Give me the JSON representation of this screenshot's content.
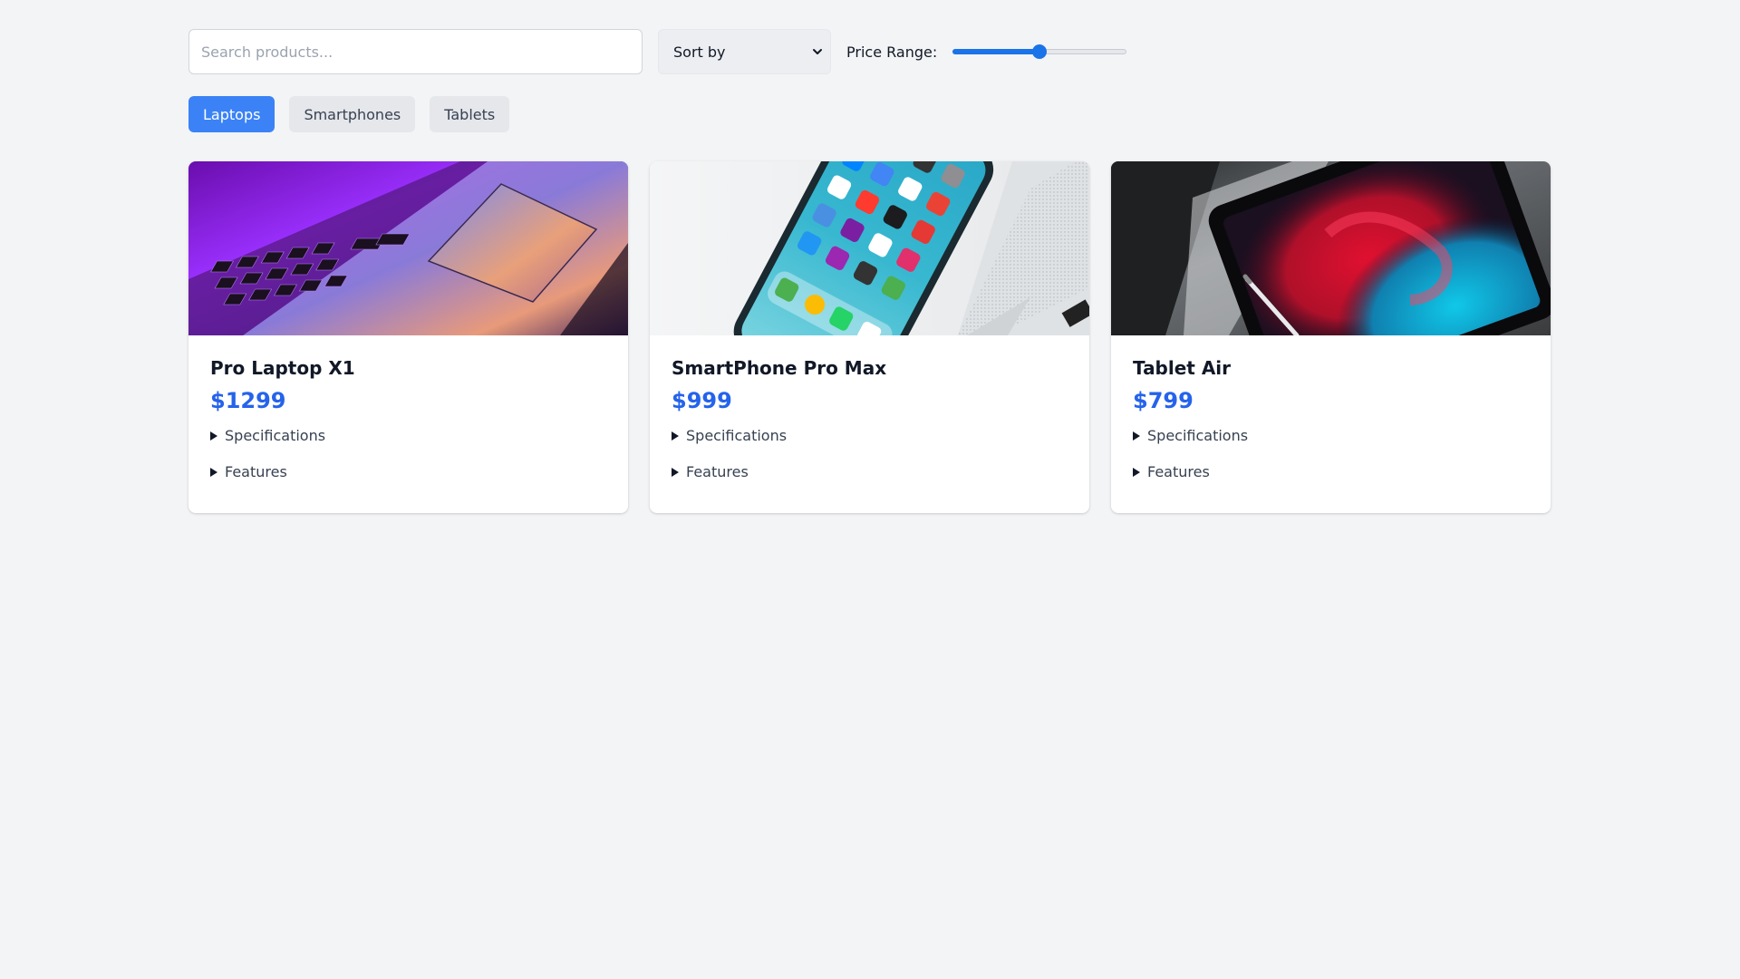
{
  "search": {
    "placeholder": "Search products...",
    "value": ""
  },
  "sort": {
    "selected": "Sort by",
    "icon": "chevron-down-icon"
  },
  "price_filter": {
    "label": "Price Range:",
    "value_fraction": 0.5,
    "accent_color": "#1a73e8"
  },
  "categories": {
    "items": [
      {
        "label": "Laptops",
        "active": true
      },
      {
        "label": "Smartphones",
        "active": false
      },
      {
        "label": "Tablets",
        "active": false
      }
    ],
    "active_color": "#3b82f6"
  },
  "products": [
    {
      "name": "Pro Laptop X1",
      "price": "$1299",
      "image": "laptop-keyboard-photo",
      "details": [
        "Specifications",
        "Features"
      ]
    },
    {
      "name": "SmartPhone Pro Max",
      "price": "$999",
      "image": "smartphone-home-screen-photo",
      "details": [
        "Specifications",
        "Features"
      ]
    },
    {
      "name": "Tablet Air",
      "price": "$799",
      "image": "tablet-on-desk-photo",
      "details": [
        "Specifications",
        "Features"
      ]
    }
  ],
  "colors": {
    "price": "#2563eb",
    "background": "#f3f4f6"
  }
}
